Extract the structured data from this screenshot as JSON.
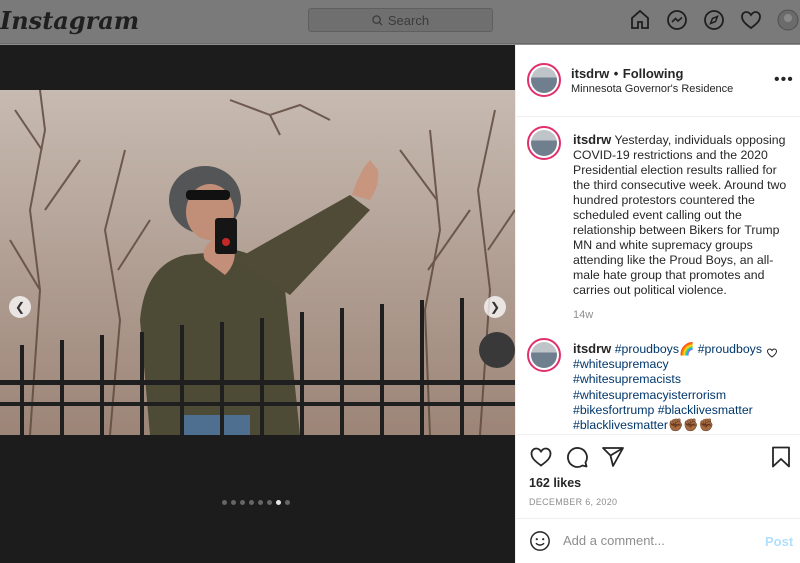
{
  "nav": {
    "logo": "Instagram",
    "search_placeholder": "Search"
  },
  "post": {
    "username": "itsdrw",
    "follow_separator": "•",
    "follow_status": "Following",
    "location": "Minnesota Governor's Residence",
    "caption": "Yesterday, individuals opposing COVID-19 restrictions and the 2020 Presidential election results rallied for the third consecutive week. Around two hundred protestors countered the scheduled event calling out the relationship between Bikers for Trump MN and white supremacy groups attending like the Proud Boys, an all-male hate group that promotes and carries out political violence.",
    "caption_age": "14w",
    "comment": {
      "username": "itsdrw",
      "tags": [
        "#proudboys🌈",
        "#proudboys",
        "#whitesupremacy",
        "#whitesupremacists",
        "#whitesupremacyisterrorism",
        "#bikesfortrump",
        "#blacklivesmatter",
        "#blacklivesmatter✊🏾✊🏾✊🏾"
      ]
    },
    "likes": "162 likes",
    "date": "DECEMBER 6, 2020",
    "carousel": {
      "total": 8,
      "active_index": 6
    }
  },
  "add_comment": {
    "placeholder": "Add a comment...",
    "post_label": "Post"
  },
  "colors": {
    "link": "#00376b",
    "post_disabled": "#b2dffc",
    "ring": "#e1306c"
  }
}
